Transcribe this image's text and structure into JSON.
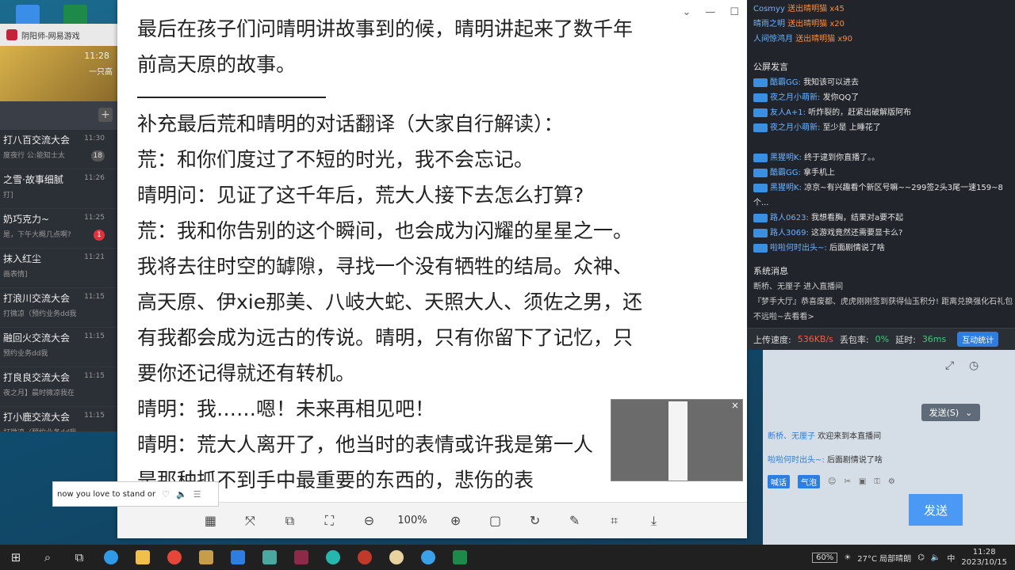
{
  "viewer": {
    "text_lines": [
      "最后在孩子们问晴明讲故事到的候，晴明讲起来了数千年",
      "前高天原的故事。"
    ],
    "text_lines_after_rule": [
      "补充最后荒和晴明的对话翻译（大家自行解读）：",
      "荒：和你们度过了不短的时光，我不会忘记。",
      "晴明问：见证了这千年后，荒大人接下去怎么打算?",
      "荒：我和你告别的这个瞬间，也会成为闪耀的星星之一。",
      "我将去往时空的罅隙，寻找一个没有牺牲的结局。众神、",
      "高天原、伊xie那美、八岐大蛇、天照大人、须佐之男，还",
      "有我都会成为远古的传说。晴明，只有你留下了记忆，只",
      "要你还记得就还有转机。",
      "晴明：我……嗯！未来再相见吧！",
      "晴明：荒大人离开了，他当时的表情或许我是第一人",
      "是那种抓不到手中最重要的东西的，悲伤的表"
    ],
    "zoom": "100%",
    "controls": {
      "minimize": "⌄",
      "restore": "—",
      "maximize": "☐"
    }
  },
  "chat_app": {
    "title": "阴阳师-网易游戏",
    "banner_time": "11:28",
    "banner_sub": "一只高",
    "plus": "+",
    "items": [
      {
        "name": "打八百交流大会",
        "msg": "度夜行 公:能知士太",
        "time": "11:30",
        "badge": "18",
        "badge_color": "grey"
      },
      {
        "name": "之雪·故事细腻",
        "msg": "打]",
        "time": "11:26",
        "badge": "",
        "badge_color": ""
      },
      {
        "name": "奶巧克力~",
        "msg": "是，下午大概几点啊?",
        "time": "11:25",
        "badge": "1",
        "badge_color": "red"
      },
      {
        "name": "抹入红尘",
        "msg": "画表情]",
        "time": "11:21",
        "badge": "",
        "badge_color": ""
      },
      {
        "name": "打浪川交流大会",
        "msg": "打微凉（预约业务dd我",
        "time": "11:15",
        "badge": "",
        "badge_color": ""
      },
      {
        "name": "融回火交流大会",
        "msg": "预约业务dd我",
        "time": "11:15",
        "badge": "",
        "badge_color": ""
      },
      {
        "name": "打良良交流大会",
        "msg": "夜之月】晨时微凉我在",
        "time": "11:15",
        "badge": "",
        "badge_color": ""
      },
      {
        "name": "打小鹿交流大会",
        "msg": "打微凉（预约业务dd我",
        "time": "11:15",
        "badge": "",
        "badge_color": ""
      }
    ]
  },
  "live": {
    "gifts": [
      {
        "user": "Cosmyy",
        "action": "送出晴明猫",
        "count": "x45"
      },
      {
        "user": "晴雨之明",
        "action": "送出晴明猫",
        "count": "x20"
      },
      {
        "user": "人间惊鸿月",
        "action": "送出晴明猫",
        "count": "x90"
      }
    ],
    "public_header": "公屏发言",
    "messages": [
      {
        "user": "酷霸GG:",
        "text": "我知该可以进去",
        "wrap": false
      },
      {
        "user": "夜之月小萌新:",
        "text": "发你QQ了",
        "wrap": false
      },
      {
        "user": "友人A+1:",
        "text": "听炸裂的，赶紧出破解版阿布",
        "wrap": false
      },
      {
        "user": "夜之月小萌新:",
        "text": "至少是 上睡花了",
        "wrap": true
      },
      {
        "user": "黑猩明K:",
        "text": "终于逮到你直播了。。",
        "wrap": false
      },
      {
        "user": "酷霸GG:",
        "text": "拿手机上",
        "wrap": false
      },
      {
        "user": "黑猩明K:",
        "text": "凉京~有兴趣看个新区号嘛~~299签2头3尾一速159~8个...",
        "wrap": true
      },
      {
        "user": "路人0623:",
        "text": "我想看胸，结果对a要不起",
        "wrap": false
      },
      {
        "user": "路人3069:",
        "text": "这游戏竟然还需要显卡么?",
        "wrap": false
      },
      {
        "user": "啦啦何时出头~:",
        "text": "后面剧情说了啥",
        "wrap": false
      }
    ],
    "system_header": "系统消息",
    "system_lines": [
      "断桥、无厘子 进入直播间",
      "『梦手大厅』恭喜废都、虎虎刚刚签到获得仙玉积分! 距离兑换强化石礼包不远啦~去看看>"
    ],
    "status": {
      "upload_label": "上传速度:",
      "upload_value": "536KB/s",
      "loss_label": "丢包率:",
      "loss_value": "0%",
      "delay_label": "延时:",
      "delay_value": "36ms",
      "button": "互动统计"
    }
  },
  "lower": {
    "send_small": "发送(S)",
    "msg1_user": "断桥、无厘子",
    "msg1_text": "欢迎来到本直播间",
    "msg2_user": "啦啦何时出头~:",
    "msg2_text": "后面剧情说了啥",
    "tools": [
      "喊话",
      "气泡"
    ],
    "send_big": "发送"
  },
  "music": {
    "text": "now you love to stand or"
  },
  "taskbar": {
    "battery": "60%",
    "weather": "27°C 局部晴朗",
    "ime": "中",
    "time": "11:28",
    "date": "2023/10/15"
  }
}
